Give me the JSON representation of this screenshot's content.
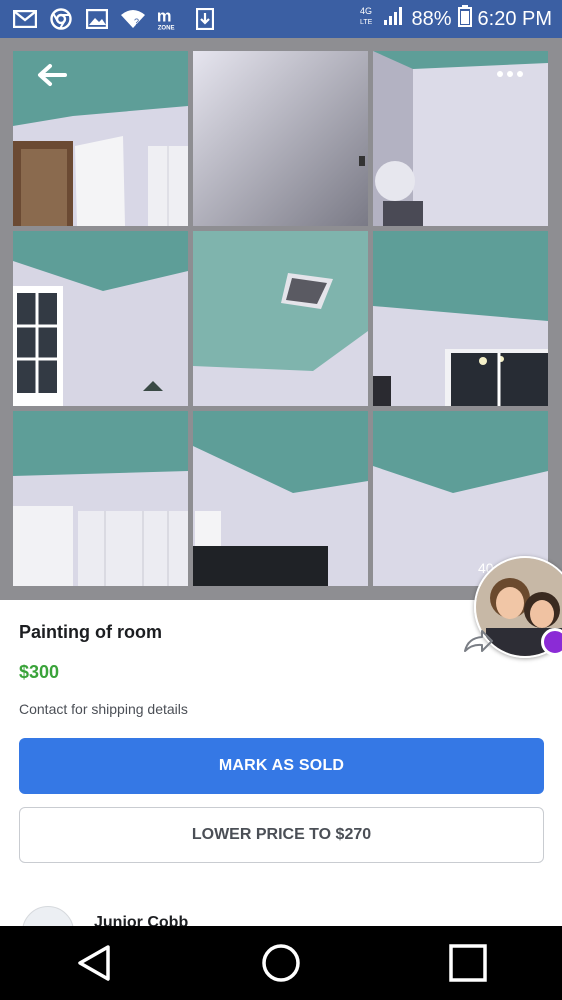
{
  "status_bar": {
    "network_label": "4G LTE",
    "battery": "88%",
    "time": "6:20 PM",
    "app_icons": [
      "gmail-icon",
      "chrome-icon",
      "gallery-icon",
      "wifi-icon",
      "mzone-icon",
      "download-icon"
    ]
  },
  "gallery": {
    "photo_count_label": "40",
    "photos": [
      "room-photo-1",
      "room-photo-2",
      "room-photo-3",
      "room-photo-4",
      "room-photo-5",
      "room-photo-6",
      "room-photo-7",
      "room-photo-8",
      "room-photo-9"
    ]
  },
  "listing": {
    "title": "Painting of room",
    "price": "$300",
    "shipping_text": "Contact for shipping details"
  },
  "actions": {
    "mark_sold_label": "MARK AS SOLD",
    "lower_price_label": "LOWER PRICE TO $270"
  },
  "seller": {
    "name": "Junior Cobb"
  },
  "colors": {
    "status_bar": "#3b5fa3",
    "primary_button": "#3578e5",
    "price_green": "#3aa33a",
    "ceiling_teal": "#5e9e98",
    "wall_lavender": "#d9d6e8"
  }
}
